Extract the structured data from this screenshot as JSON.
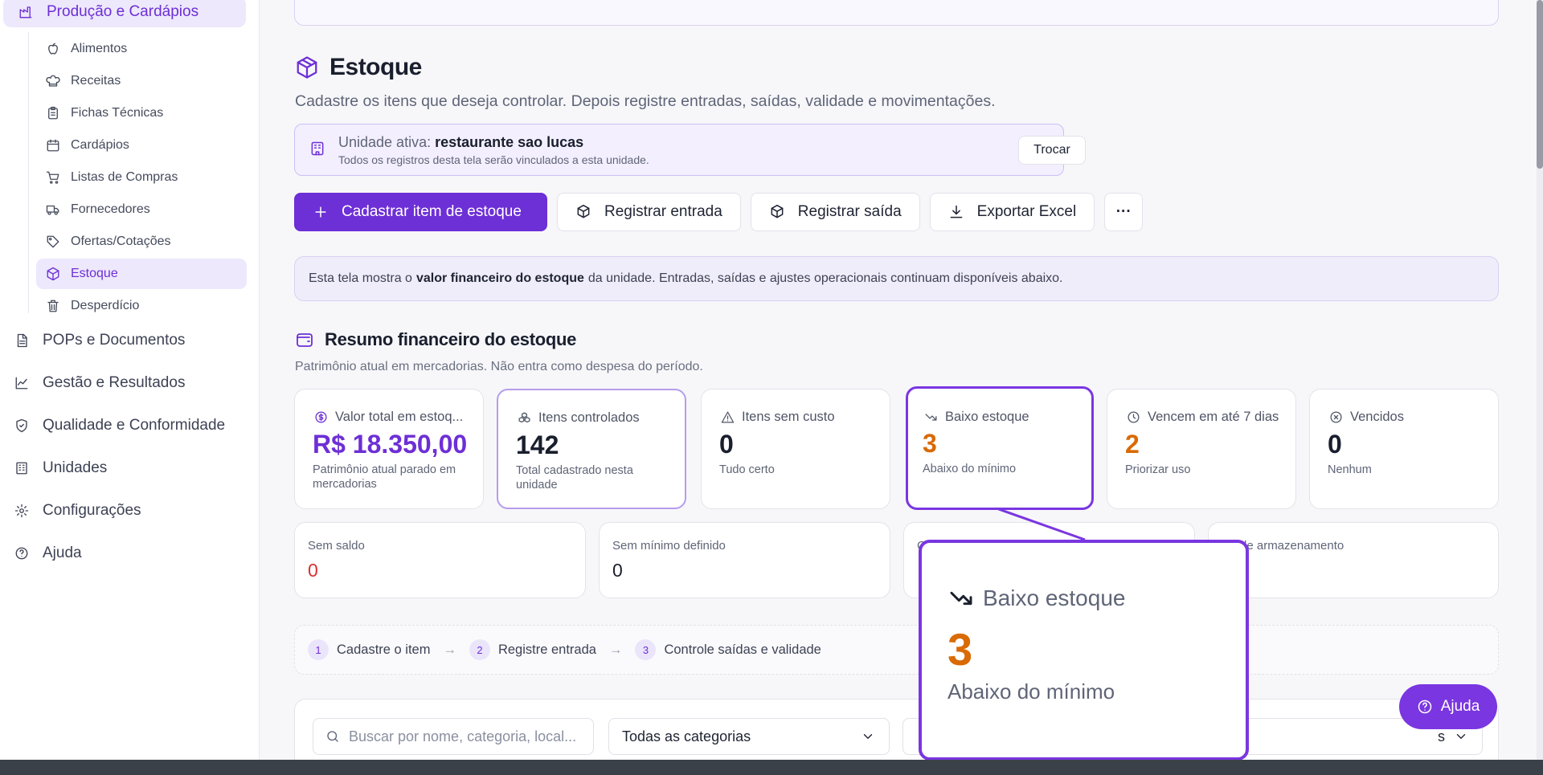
{
  "sidebar": {
    "section_title": "Produção e Cardápios",
    "sub_items": [
      {
        "label": "Alimentos",
        "icon": "apple-icon"
      },
      {
        "label": "Receitas",
        "icon": "chef-hat-icon"
      },
      {
        "label": "Fichas Técnicas",
        "icon": "clipboard-icon"
      },
      {
        "label": "Cardápios",
        "icon": "calendar-icon"
      },
      {
        "label": "Listas de Compras",
        "icon": "cart-icon"
      },
      {
        "label": "Fornecedores",
        "icon": "truck-icon"
      },
      {
        "label": "Ofertas/Cotações",
        "icon": "tag-icon"
      },
      {
        "label": "Estoque",
        "icon": "package-icon",
        "active": true
      },
      {
        "label": "Desperdício",
        "icon": "trash-icon"
      }
    ],
    "main_items": [
      {
        "label": "POPs e Documentos",
        "icon": "document-icon"
      },
      {
        "label": "Gestão e Resultados",
        "icon": "chart-line-icon"
      },
      {
        "label": "Qualidade e Conformidade",
        "icon": "shield-check-icon"
      },
      {
        "label": "Unidades",
        "icon": "building-icon"
      },
      {
        "label": "Configurações",
        "icon": "gear-icon"
      },
      {
        "label": "Ajuda",
        "icon": "help-circle-icon"
      }
    ]
  },
  "page": {
    "title": "Estoque",
    "description": "Cadastre os itens que deseja controlar. Depois registre entradas, saídas, validade e movimentações."
  },
  "unit": {
    "prefix": "Unidade ativa:",
    "name": "restaurante sao lucas",
    "note": "Todos os registros desta tela serão vinculados a esta unidade.",
    "switch_label": "Trocar"
  },
  "actions": {
    "add_item": "Cadastrar item de estoque",
    "entry": "Registrar entrada",
    "exit": "Registrar saída",
    "export": "Exportar Excel",
    "more": "···"
  },
  "info": {
    "before": "Esta tela mostra o",
    "bold": "valor financeiro do estoque",
    "after": "da unidade. Entradas, saídas e ajustes operacionais continuam disponíveis abaixo."
  },
  "summary": {
    "title": "Resumo financeiro do estoque",
    "description": "Patrimônio atual em mercadorias. Não entra como despesa do período.",
    "cards": [
      {
        "label": "Valor total em estoq...",
        "value": "R$ 18.350,00",
        "sub": "Patrimônio atual parado em mercadorias",
        "icon": "dollar-circle-icon"
      },
      {
        "label": "Itens controlados",
        "value": "142",
        "sub": "Total cadastrado nesta unidade",
        "icon": "boxes-icon"
      },
      {
        "label": "Itens sem custo",
        "value": "0",
        "sub": "Tudo certo",
        "icon": "warning-icon"
      },
      {
        "label": "Baixo estoque",
        "value": "3",
        "sub": "Abaixo do mínimo",
        "icon": "trending-down-icon"
      },
      {
        "label": "Vencem em até 7 dias",
        "value": "2",
        "sub": "Priorizar uso",
        "icon": "clock-icon"
      },
      {
        "label": "Vencidos",
        "value": "0",
        "sub": "Nenhum",
        "icon": "x-circle-icon"
      }
    ],
    "cards_row2": [
      {
        "label": "Sem saldo",
        "value": "0"
      },
      {
        "label": "Sem mínimo definido",
        "value": "0"
      },
      {
        "label": "C",
        "value": ""
      },
      {
        "label": "is de armazenamento",
        "value": ""
      }
    ]
  },
  "steps": [
    {
      "num": "1",
      "label": "Cadastre o item"
    },
    {
      "num": "2",
      "label": "Registre entrada"
    },
    {
      "num": "3",
      "label": "Controle saídas e validade"
    }
  ],
  "filters": {
    "search_placeholder": "Buscar por nome, categoria, local...",
    "category_value": "Todas as categorias",
    "last_select_tail": "s"
  },
  "zoom": {
    "label": "Baixo estoque",
    "value": "3",
    "sub": "Abaixo do mínimo"
  },
  "help_button": "Ajuda",
  "colors": {
    "accent": "#6d2fd6",
    "warning_orange": "#d96a05",
    "danger_red": "#d93030"
  }
}
